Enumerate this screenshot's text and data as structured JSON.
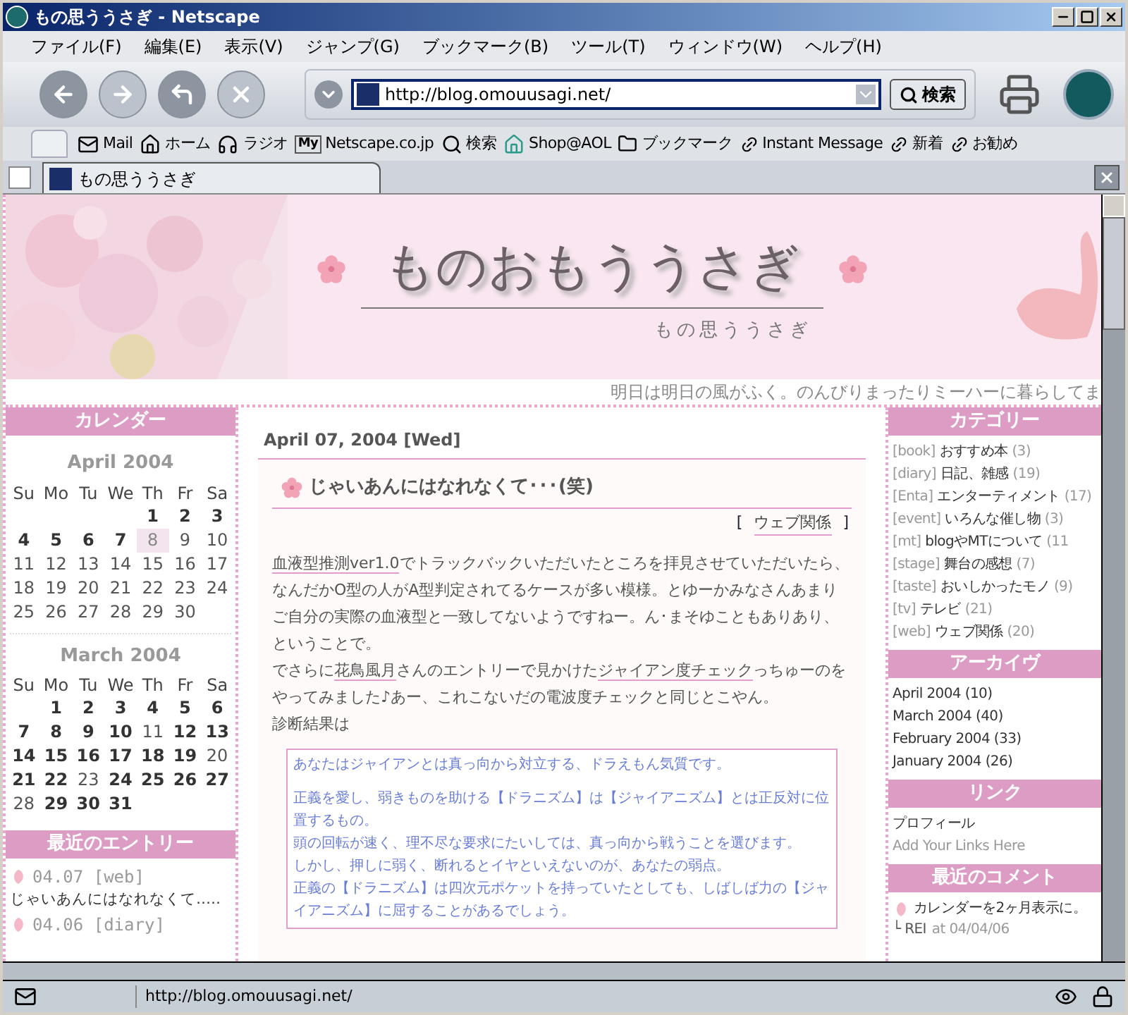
{
  "window": {
    "title": "もの思ううさぎ - Netscape"
  },
  "menu": [
    "ファイル(F)",
    "編集(E)",
    "表示(V)",
    "ジャンプ(G)",
    "ブックマーク(B)",
    "ツール(T)",
    "ウィンドウ(W)",
    "ヘルプ(H)"
  ],
  "nav_buttons": [
    {
      "kind": "back",
      "disabled": false
    },
    {
      "kind": "forward",
      "disabled": true
    },
    {
      "kind": "reload",
      "disabled": false
    },
    {
      "kind": "stop",
      "disabled": true
    }
  ],
  "address": {
    "value": "http://blog.omouusagi.net/"
  },
  "search_button": "検索",
  "personal_toolbar": [
    {
      "kind": "mail",
      "label": "Mail"
    },
    {
      "kind": "home",
      "label": "ホーム"
    },
    {
      "kind": "radio",
      "label": "ラジオ"
    },
    {
      "kind": "my",
      "badge": "My",
      "label": "Netscape.co.jp"
    },
    {
      "kind": "search",
      "label": "検索"
    },
    {
      "kind": "shop",
      "label": "Shop@AOL"
    },
    {
      "kind": "folder",
      "label": "ブックマーク"
    },
    {
      "kind": "link",
      "label": "Instant Message"
    },
    {
      "kind": "link",
      "label": "新着"
    },
    {
      "kind": "link",
      "label": "お勧め"
    }
  ],
  "tabs": [
    {
      "label": "もの思ううさぎ",
      "selected": true
    }
  ],
  "header": {
    "logo": "ものおもううさぎ",
    "subtitle": "もの思ううさぎ",
    "tagline": "明日は明日の風がふく。のんびりまったりミーハーに暮らしてま"
  },
  "calendar": {
    "title": "カレンダー",
    "months": [
      {
        "title": "April 2004",
        "weekdays": [
          "Su",
          "Mo",
          "Tu",
          "We",
          "Th",
          "Fr",
          "Sa"
        ],
        "weeks": [
          [
            {
              "kind": "blank"
            },
            {
              "kind": "blank"
            },
            {
              "kind": "blank"
            },
            {
              "kind": "blank"
            },
            {
              "kind": "day",
              "day": "1",
              "bold": true,
              "selected": false
            },
            {
              "kind": "day",
              "day": "2",
              "bold": true,
              "selected": false
            },
            {
              "kind": "day",
              "day": "3",
              "bold": true,
              "selected": false
            }
          ],
          [
            {
              "kind": "day",
              "day": "4",
              "bold": true,
              "selected": false
            },
            {
              "kind": "day",
              "day": "5",
              "bold": true,
              "selected": false
            },
            {
              "kind": "day",
              "day": "6",
              "bold": true,
              "selected": false
            },
            {
              "kind": "day",
              "day": "7",
              "bold": true,
              "selected": false
            },
            {
              "kind": "day",
              "day": "8",
              "bold": false,
              "selected": true
            },
            {
              "kind": "day",
              "day": "9",
              "bold": false,
              "selected": false
            },
            {
              "kind": "day",
              "day": "10",
              "bold": false,
              "selected": false
            }
          ],
          [
            {
              "kind": "day",
              "day": "11",
              "bold": false,
              "selected": false
            },
            {
              "kind": "day",
              "day": "12",
              "bold": false,
              "selected": false
            },
            {
              "kind": "day",
              "day": "13",
              "bold": false,
              "selected": false
            },
            {
              "kind": "day",
              "day": "14",
              "bold": false,
              "selected": false
            },
            {
              "kind": "day",
              "day": "15",
              "bold": false,
              "selected": false
            },
            {
              "kind": "day",
              "day": "16",
              "bold": false,
              "selected": false
            },
            {
              "kind": "day",
              "day": "17",
              "bold": false,
              "selected": false
            }
          ],
          [
            {
              "kind": "day",
              "day": "18",
              "bold": false,
              "selected": false
            },
            {
              "kind": "day",
              "day": "19",
              "bold": false,
              "selected": false
            },
            {
              "kind": "day",
              "day": "20",
              "bold": false,
              "selected": false
            },
            {
              "kind": "day",
              "day": "21",
              "bold": false,
              "selected": false
            },
            {
              "kind": "day",
              "day": "22",
              "bold": false,
              "selected": false
            },
            {
              "kind": "day",
              "day": "23",
              "bold": false,
              "selected": false
            },
            {
              "kind": "day",
              "day": "24",
              "bold": false,
              "selected": false
            }
          ],
          [
            {
              "kind": "day",
              "day": "25",
              "bold": false,
              "selected": false
            },
            {
              "kind": "day",
              "day": "26",
              "bold": false,
              "selected": false
            },
            {
              "kind": "day",
              "day": "27",
              "bold": false,
              "selected": false
            },
            {
              "kind": "day",
              "day": "28",
              "bold": false,
              "selected": false
            },
            {
              "kind": "day",
              "day": "29",
              "bold": false,
              "selected": false
            },
            {
              "kind": "day",
              "day": "30",
              "bold": false,
              "selected": false
            },
            {
              "kind": "blank"
            }
          ]
        ]
      },
      {
        "title": "March 2004",
        "weekdays": [
          "Su",
          "Mo",
          "Tu",
          "We",
          "Th",
          "Fr",
          "Sa"
        ],
        "weeks": [
          [
            {
              "kind": "blank"
            },
            {
              "kind": "day",
              "day": "1",
              "bold": true,
              "selected": false
            },
            {
              "kind": "day",
              "day": "2",
              "bold": true,
              "selected": false
            },
            {
              "kind": "day",
              "day": "3",
              "bold": true,
              "selected": false
            },
            {
              "kind": "day",
              "day": "4",
              "bold": true,
              "selected": false
            },
            {
              "kind": "day",
              "day": "5",
              "bold": true,
              "selected": false
            },
            {
              "kind": "day",
              "day": "6",
              "bold": true,
              "selected": false
            }
          ],
          [
            {
              "kind": "day",
              "day": "7",
              "bold": true,
              "selected": false
            },
            {
              "kind": "day",
              "day": "8",
              "bold": true,
              "selected": false
            },
            {
              "kind": "day",
              "day": "9",
              "bold": true,
              "selected": false
            },
            {
              "kind": "day",
              "day": "10",
              "bold": true,
              "selected": false
            },
            {
              "kind": "day",
              "day": "11",
              "bold": false,
              "selected": false
            },
            {
              "kind": "day",
              "day": "12",
              "bold": true,
              "selected": false
            },
            {
              "kind": "day",
              "day": "13",
              "bold": true,
              "selected": false
            }
          ],
          [
            {
              "kind": "day",
              "day": "14",
              "bold": true,
              "selected": false
            },
            {
              "kind": "day",
              "day": "15",
              "bold": true,
              "selected": false
            },
            {
              "kind": "day",
              "day": "16",
              "bold": true,
              "selected": false
            },
            {
              "kind": "day",
              "day": "17",
              "bold": true,
              "selected": false
            },
            {
              "kind": "day",
              "day": "18",
              "bold": true,
              "selected": false
            },
            {
              "kind": "day",
              "day": "19",
              "bold": true,
              "selected": false
            },
            {
              "kind": "day",
              "day": "20",
              "bold": false,
              "selected": false
            }
          ],
          [
            {
              "kind": "day",
              "day": "21",
              "bold": true,
              "selected": false
            },
            {
              "kind": "day",
              "day": "22",
              "bold": true,
              "selected": false
            },
            {
              "kind": "day",
              "day": "23",
              "bold": false,
              "selected": false
            },
            {
              "kind": "day",
              "day": "24",
              "bold": true,
              "selected": false
            },
            {
              "kind": "day",
              "day": "25",
              "bold": true,
              "selected": false
            },
            {
              "kind": "day",
              "day": "26",
              "bold": true,
              "selected": false
            },
            {
              "kind": "day",
              "day": "27",
              "bold": true,
              "selected": false
            }
          ],
          [
            {
              "kind": "day",
              "day": "28",
              "bold": false,
              "selected": false
            },
            {
              "kind": "day",
              "day": "29",
              "bold": true,
              "selected": false
            },
            {
              "kind": "day",
              "day": "30",
              "bold": true,
              "selected": false
            },
            {
              "kind": "day",
              "day": "31",
              "bold": true,
              "selected": false
            },
            {
              "kind": "blank"
            },
            {
              "kind": "blank"
            },
            {
              "kind": "blank"
            }
          ]
        ]
      }
    ]
  },
  "recent_entries": {
    "title": "最近のエントリー",
    "items": [
      {
        "meta": "04.07 [web]",
        "text": "じゃいあんにはなれなくて‥…"
      },
      {
        "meta": "04.06 [diary]"
      }
    ]
  },
  "post": {
    "date": "April 07, 2004 [Wed]",
    "title": "じゃいあんにはなれなくて･･･(笑)",
    "category": "ウェブ関係",
    "bracket_open": "[",
    "bracket_close": "]",
    "paragraphs": [
      [
        {
          "text": "血液型推測ver1.0",
          "link": true
        },
        {
          "text": "でトラックバックいただいたところを拝見させていただいたら、なんだかO型の人がA型判定されてるケースが多い模様。とゆーかみなさんあまりご自分の実際の血液型と一致してないようですねー。ん･まそゆこともありあり、ということで。",
          "link": false
        }
      ],
      [
        {
          "text": "でさらに",
          "link": false
        },
        {
          "text": "花鳥風月",
          "link": true
        },
        {
          "text": "さんのエントリーで見かけた",
          "link": false
        },
        {
          "text": "ジャイアン度チェック",
          "link": true
        },
        {
          "text": "っちゅーのをやってみました♪あー、これこないだの電波度チェックと同じとこやん。",
          "link": false
        }
      ],
      [
        {
          "text": "診断結果は",
          "link": false
        }
      ]
    ],
    "result": {
      "lead": "あなたはジャイアンとは真っ向から対立する、ドラえもん気質です。",
      "lines": [
        "正義を愛し、弱きものを助ける【ドラニズム】は【ジャイアニズム】とは正反対に位置するもの。",
        "頭の回転が速く、理不尽な要求にたいしては、真っ向から戦うことを選びます。",
        "しかし、押しに弱く、断れるとイヤといえないのが、あなたの弱点。",
        "正義の【ドラニズム】は四次元ポケットを持っていたとしても、しばしば力の【ジャイアニズム】に屈することがあるでしょう。"
      ]
    }
  },
  "categories": {
    "title": "カテゴリー",
    "items": [
      {
        "tag": "[book]",
        "name": "おすすめ本",
        "count": "(3)"
      },
      {
        "tag": "[diary]",
        "name": "日記、雑感",
        "count": "(19)"
      },
      {
        "tag": "[Enta]",
        "name": "エンターティメント",
        "count": "(17)"
      },
      {
        "tag": "[event]",
        "name": "いろんな催し物",
        "count": "(3)"
      },
      {
        "tag": "[mt]",
        "name": "blogやMTについて",
        "count": "(11"
      },
      {
        "tag": "[stage]",
        "name": "舞台の感想",
        "count": "(7)"
      },
      {
        "tag": "[taste]",
        "name": "おいしかったモノ",
        "count": "(9)"
      },
      {
        "tag": "[tv]",
        "name": "テレビ",
        "count": "(21)"
      },
      {
        "tag": "[web]",
        "name": "ウェブ関係",
        "count": "(20)"
      }
    ]
  },
  "archives": {
    "title": "アーカイヴ",
    "items": [
      "April 2004 (10)",
      "March 2004 (40)",
      "February 2004 (33)",
      "January 2004 (26)"
    ]
  },
  "links": {
    "title": "リンク",
    "items": [
      {
        "text": "プロフィール",
        "muted": false
      },
      {
        "text": "Add Your Links Here",
        "muted": true
      }
    ]
  },
  "recent_comments": {
    "title": "最近のコメント",
    "items": [
      {
        "text": "カレンダーを2ヶ月表示に。",
        "author": "└ REI",
        "at": "at 04/04/06"
      }
    ]
  },
  "status_bar": {
    "text": "http://blog.omouusagi.net/"
  }
}
